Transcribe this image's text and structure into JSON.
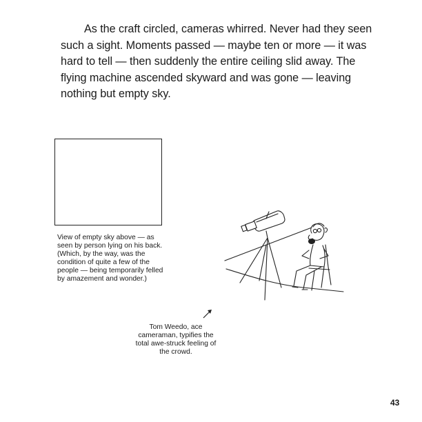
{
  "page": {
    "body_text": "As the craft circled, cameras whirred. Never had they seen such a sight. Moments passed — maybe ten or more — it was hard to tell — then suddenly the entire ceiling slid away. The flying machine ascended skyward and was gone — leaving nothing but empty sky.",
    "sky_caption": "View of empty sky above — as seen by person lying on his back. (Which, by the way, was the condition of quite a few of the people — being temporarily felled by amazement and wonder.)",
    "cameraman_caption": "Tom Weedo, ace cameraman, typifies the total awe-struck feeling of the crowd.",
    "page_number": "43"
  },
  "icons": {
    "arrow": "arrow-up-right-icon",
    "illustration": "cameraman-with-tripod-camera-drawing"
  },
  "colors": {
    "ink": "#1a1a1a",
    "paper": "#ffffff"
  }
}
